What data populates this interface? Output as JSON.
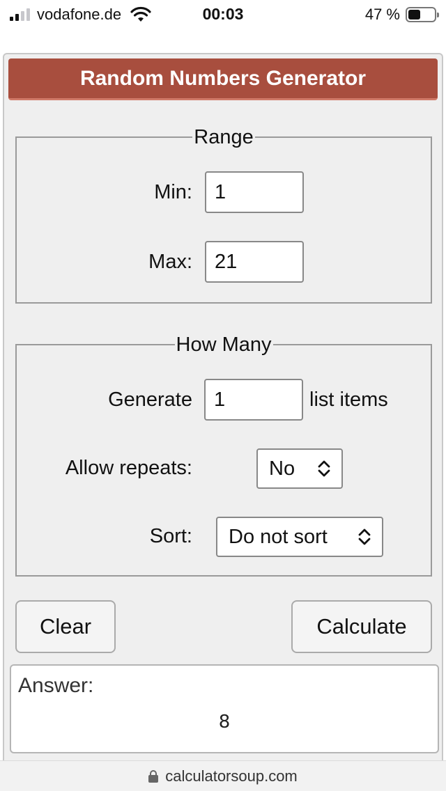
{
  "status_bar": {
    "carrier": "vodafone.de",
    "time": "00:03",
    "battery_percent": "47 %",
    "battery_level": 0.47,
    "signal_bars": 2
  },
  "calculator": {
    "title": "Random Numbers Generator",
    "range": {
      "legend": "Range",
      "min_label": "Min:",
      "min_value": "1",
      "max_label": "Max:",
      "max_value": "21"
    },
    "how_many": {
      "legend": "How Many",
      "generate_label": "Generate",
      "generate_value": "1",
      "generate_suffix": "list items",
      "repeats_label": "Allow repeats:",
      "repeats_value": "No",
      "sort_label": "Sort:",
      "sort_value": "Do not sort"
    },
    "buttons": {
      "clear": "Clear",
      "calculate": "Calculate"
    },
    "answer": {
      "label": "Answer:",
      "value": "8"
    }
  },
  "url_bar": {
    "domain": "calculatorsoup.com"
  },
  "colors": {
    "header_bg": "#a84e3e",
    "panel_bg": "#efefef"
  }
}
